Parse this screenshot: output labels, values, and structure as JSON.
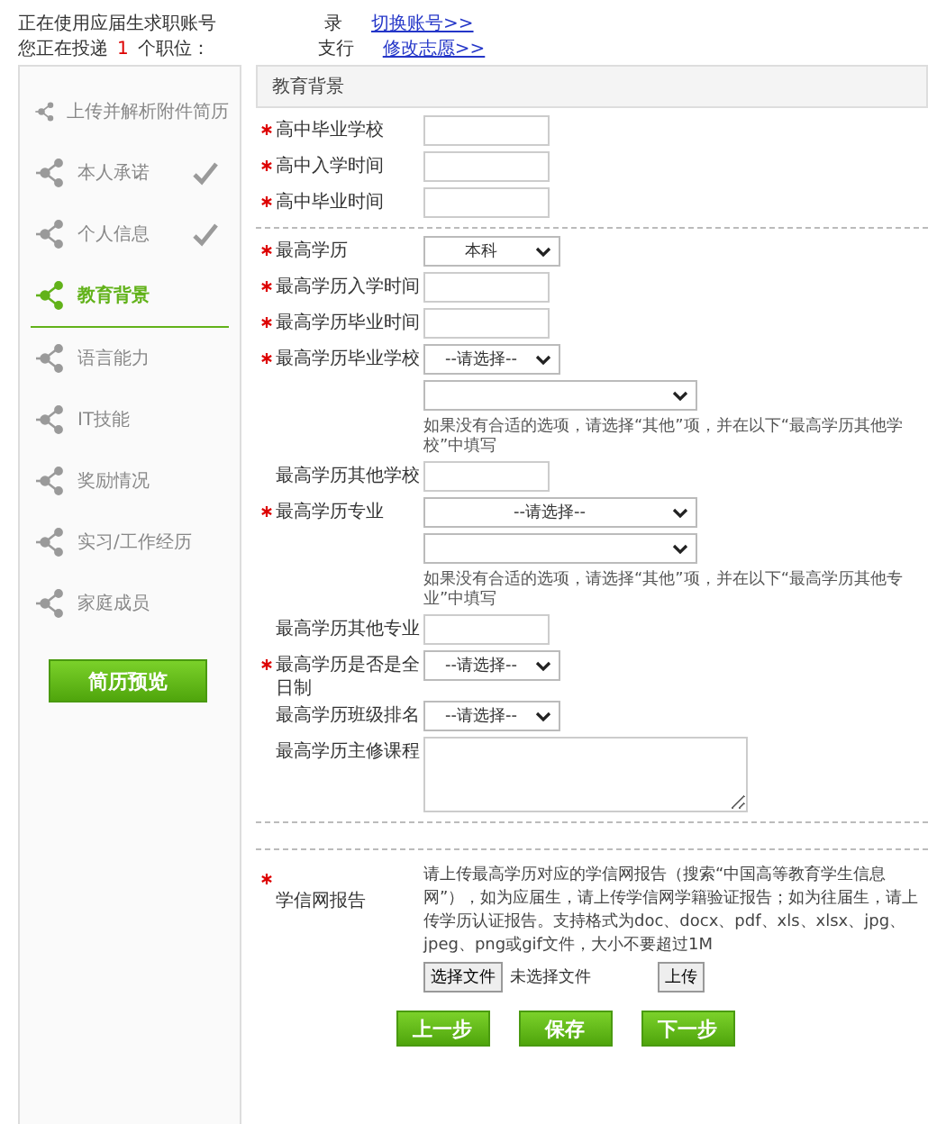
{
  "header": {
    "account_prefix": "正在使用应届生求职账号",
    "account_suffix": "录",
    "switch_link": "切换账号>>",
    "applying_prefix": "您正在投递",
    "count": "1",
    "applying_suffix": "个职位：",
    "branch": "支行",
    "change_link": "修改志愿>>"
  },
  "sidebar": {
    "items": [
      {
        "label": "上传并解析附件简历",
        "done": false,
        "selected": false
      },
      {
        "label": "本人承诺",
        "done": true,
        "selected": false
      },
      {
        "label": "个人信息",
        "done": true,
        "selected": false
      },
      {
        "label": "教育背景",
        "done": false,
        "selected": true
      },
      {
        "label": "语言能力",
        "done": false,
        "selected": false
      },
      {
        "label": "IT技能",
        "done": false,
        "selected": false
      },
      {
        "label": "奖励情况",
        "done": false,
        "selected": false
      },
      {
        "label": "实习/工作经历",
        "done": false,
        "selected": false
      },
      {
        "label": "家庭成员",
        "done": false,
        "selected": false
      }
    ],
    "preview_button": "简历预览"
  },
  "form": {
    "section_title": "教育背景",
    "groups": [
      {
        "rows": [
          {
            "label": "高中毕业学校",
            "required": true,
            "kind": "input"
          },
          {
            "label": "高中入学时间",
            "required": true,
            "kind": "input"
          },
          {
            "label": "高中毕业时间",
            "required": true,
            "kind": "input"
          }
        ]
      },
      {
        "rows": [
          {
            "label": "最高学历",
            "required": true,
            "kind": "select",
            "value": "本科"
          },
          {
            "label": "最高学历入学时间",
            "required": true,
            "kind": "input"
          },
          {
            "label": "最高学历毕业时间",
            "required": true,
            "kind": "input"
          },
          {
            "label": "最高学历毕业学校",
            "required": true,
            "kind": "select",
            "value": "--请选择--"
          },
          {
            "kind": "select_wide"
          },
          {
            "kind": "hint",
            "text": "如果没有合适的选项，请选择“其他”项，并在以下“最高学历其他学校”中填写"
          },
          {
            "label": "最高学历其他学校",
            "required": false,
            "kind": "input"
          },
          {
            "label": "最高学历专业",
            "required": true,
            "kind": "select_wide",
            "value": "--请选择--"
          },
          {
            "kind": "select_wide"
          },
          {
            "kind": "hint",
            "text": "如果没有合适的选项，请选择“其他”项，并在以下“最高学历其他专业”中填写"
          },
          {
            "label": "最高学历其他专业",
            "required": false,
            "kind": "input"
          },
          {
            "label": "最高学历是否是全日制",
            "required": true,
            "kind": "select",
            "value": "--请选择--"
          },
          {
            "label": "最高学历班级排名",
            "required": false,
            "kind": "select",
            "value": "--请选择--"
          },
          {
            "label": "最高学历主修课程",
            "required": false,
            "kind": "textarea"
          }
        ]
      }
    ],
    "upload": {
      "required": true,
      "label": "学信网报告",
      "description": "请上传最高学历对应的学信网报告（搜索“中国高等教育学生信息网”），如为应届生，请上传学信网学籍验证报告；如为往届生，请上传学历认证报告。支持格式为doc、docx、pdf、xls、xlsx、jpg、jpeg、png或gif文件，大小不要超过1M",
      "choose_button": "选择文件",
      "no_file": "未选择文件",
      "upload_button": "上传"
    },
    "buttons": [
      "上一步",
      "保存",
      "下一步"
    ]
  }
}
